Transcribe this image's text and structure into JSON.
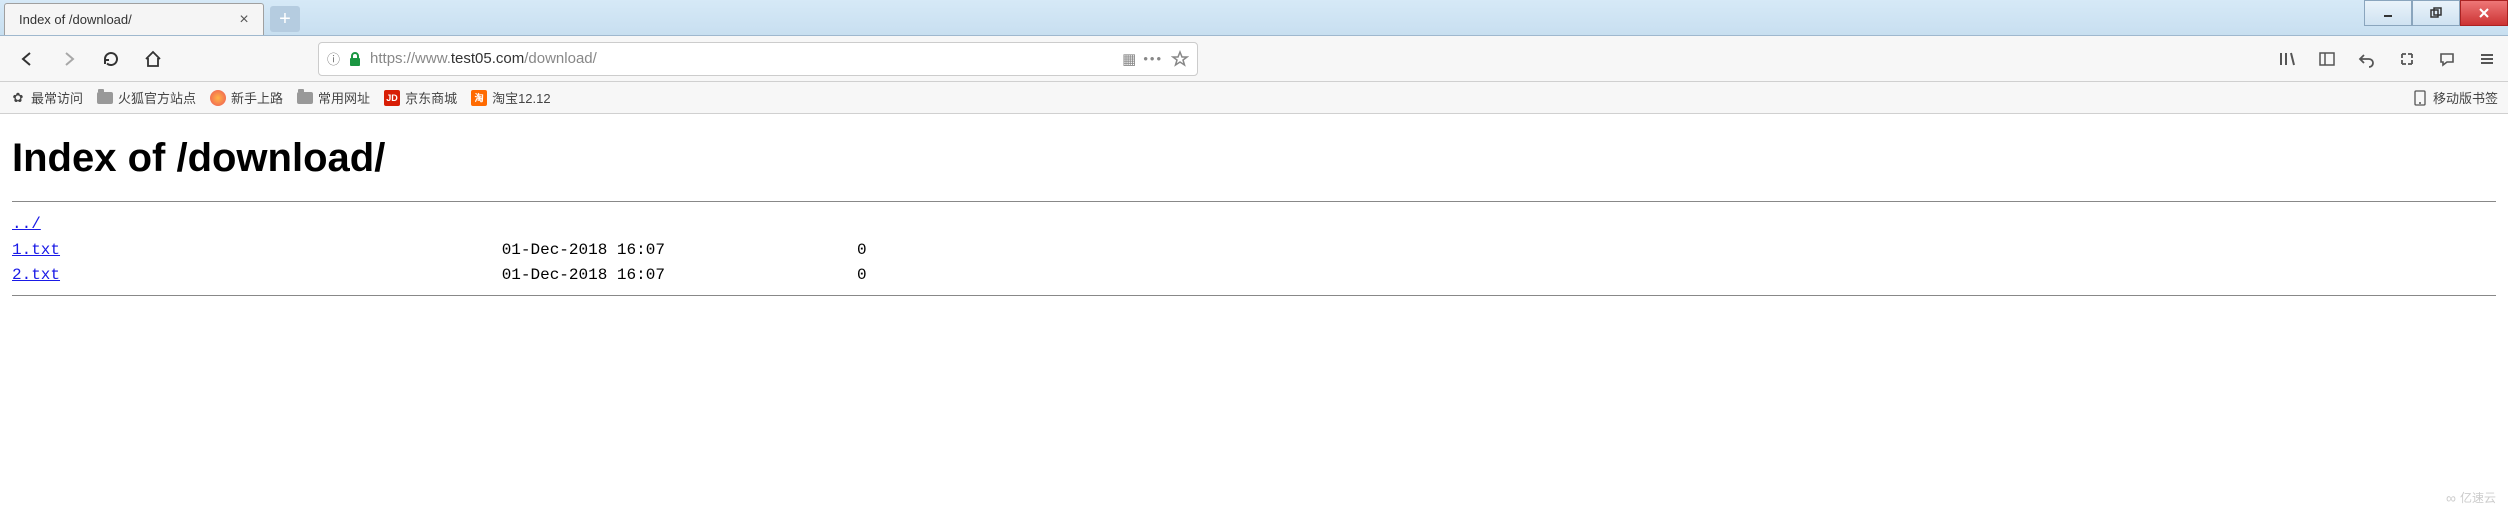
{
  "tab": {
    "title": "Index of /download/"
  },
  "url": {
    "scheme": "https://www.",
    "domain": "test05.com",
    "path": "/download/"
  },
  "nav_icons": {
    "qr": "QR",
    "dots": "•••"
  },
  "bookmarks": {
    "items": [
      {
        "label": "最常访问",
        "icon": "gear"
      },
      {
        "label": "火狐官方站点",
        "icon": "folder"
      },
      {
        "label": "新手上路",
        "icon": "firefox"
      },
      {
        "label": "常用网址",
        "icon": "folder"
      },
      {
        "label": "京东商城",
        "icon": "jd"
      },
      {
        "label": "淘宝12.12",
        "icon": "taobao"
      }
    ],
    "right": "移动版书签"
  },
  "page": {
    "heading": "Index of /download/",
    "entries": [
      {
        "name": "../",
        "date": "",
        "size": ""
      },
      {
        "name": "1.txt",
        "date": "01-Dec-2018 16:07",
        "size": "0"
      },
      {
        "name": "2.txt",
        "date": "01-Dec-2018 16:07",
        "size": "0"
      }
    ]
  },
  "watermark": "亿速云"
}
